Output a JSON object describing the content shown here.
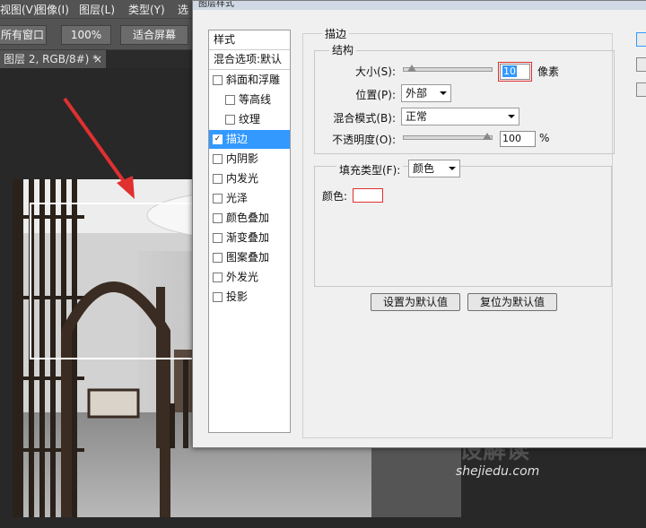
{
  "menubar": {
    "items": [
      "视图(V)",
      "图像(I)",
      "图层(L)",
      "类型(Y)",
      "选"
    ]
  },
  "options": {
    "btn_all_windows": "所有窗口",
    "zoom": "100%",
    "fit_screen": "适合屏幕"
  },
  "doc_tab": {
    "title": "图层 2, RGB/8#) *",
    "close": "×"
  },
  "dialog": {
    "title": "图层样式",
    "styles_header": "样式",
    "blend_options": "混合选项:默认",
    "style_items": [
      {
        "label": "斜面和浮雕",
        "checked": false
      },
      {
        "label": "等高线",
        "checked": false
      },
      {
        "label": "纹理",
        "checked": false
      },
      {
        "label": "描边",
        "checked": true
      },
      {
        "label": "内阴影",
        "checked": false
      },
      {
        "label": "内发光",
        "checked": false
      },
      {
        "label": "光泽",
        "checked": false
      },
      {
        "label": "颜色叠加",
        "checked": false
      },
      {
        "label": "渐变叠加",
        "checked": false
      },
      {
        "label": "图案叠加",
        "checked": false
      },
      {
        "label": "外发光",
        "checked": false
      },
      {
        "label": "投影",
        "checked": false
      }
    ],
    "checkmark": "✓",
    "stroke": {
      "section_title": "描边",
      "structure_title": "结构",
      "size_label": "大小(S):",
      "size_value": "10",
      "size_unit": "像素",
      "size_slider": 0.05,
      "position_label": "位置(P):",
      "position_value": "外部",
      "blend_label": "混合模式(B):",
      "blend_value": "正常",
      "opacity_label": "不透明度(O):",
      "opacity_value": "100",
      "opacity_unit": "%",
      "opacity_slider": 1.0,
      "fill_type_label": "填充类型(F):",
      "fill_type_value": "颜色",
      "color_label": "颜色:",
      "color_swatch": "#ffffff"
    },
    "make_default": "设置为默认值",
    "reset_default": "复位为默认值"
  },
  "watermark": {
    "brand": "设解读",
    "url": "shejiedu.com"
  },
  "colors": {
    "accent_selected": "#3399ff",
    "highlight_red": "#e03030",
    "ps_chrome": "#535353"
  }
}
